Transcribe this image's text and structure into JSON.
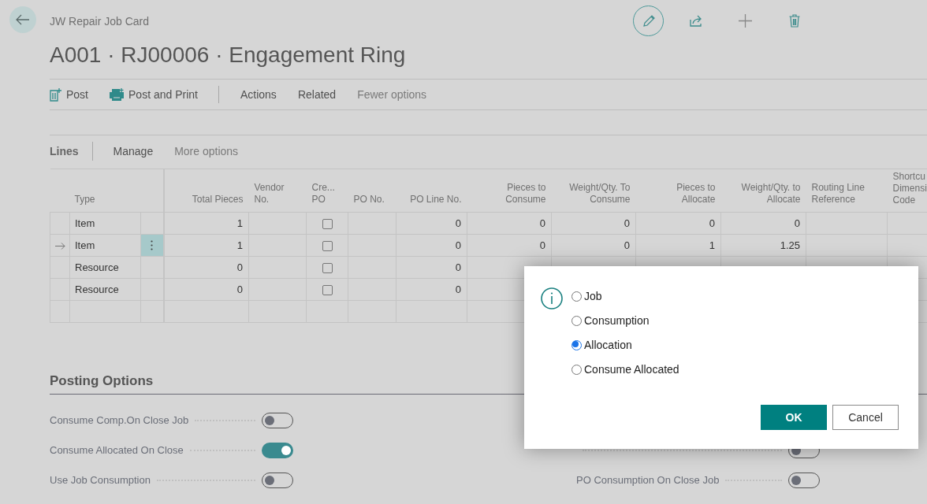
{
  "header": {
    "breadcrumb": "JW Repair Job Card",
    "title": "A001 · RJ00006 · Engagement Ring"
  },
  "action_bar": [
    {
      "label": "Post",
      "kind": "post"
    },
    {
      "label": "Post and Print",
      "kind": "print"
    },
    {
      "label": "Actions",
      "kind": "menu"
    },
    {
      "label": "Related",
      "kind": "menu"
    },
    {
      "label": "Fewer options",
      "kind": "more"
    }
  ],
  "lines": {
    "title": "Lines",
    "actions": [
      {
        "label": "Manage",
        "kind": "menu"
      },
      {
        "label": "More options",
        "kind": "more"
      }
    ],
    "table": {
      "columns": [
        {
          "label": "Total Pieces",
          "kind": "number"
        },
        {
          "label": "Vendor\nNo.",
          "kind": "text"
        },
        {
          "label": "Cre...\nPO",
          "kind": "checkbox"
        },
        {
          "label": "PO No.",
          "kind": "text"
        },
        {
          "label": "PO Line No.",
          "kind": "number"
        },
        {
          "label": "Pieces to\nConsume",
          "kind": "number"
        },
        {
          "label": "Weight/Qty. To\nConsume",
          "kind": "number"
        },
        {
          "label": "Pieces to\nAllocate",
          "kind": "number"
        },
        {
          "label": "Weight/Qty. to\nAllocate",
          "kind": "number"
        },
        {
          "label": "Routing Line\nReference",
          "kind": "text"
        },
        {
          "label": "Shortcu\nDimensi\nCode",
          "kind": "text"
        }
      ],
      "type_label": "Type",
      "rows": [
        {
          "selected": false,
          "type": "Item",
          "cells": [
            "1",
            null,
            false,
            null,
            "0",
            "0",
            "0",
            "0",
            "0",
            null,
            null
          ]
        },
        {
          "selected": true,
          "type": "Item",
          "cells": [
            "1",
            null,
            false,
            null,
            "0",
            "0",
            "0",
            "1",
            "1.25",
            null,
            null
          ]
        },
        {
          "selected": false,
          "type": "Resource",
          "cells": [
            "0",
            null,
            false,
            null,
            "0",
            null,
            null,
            null,
            null,
            null,
            null
          ]
        },
        {
          "selected": false,
          "type": "Resource",
          "cells": [
            "0",
            null,
            false,
            null,
            "0",
            null,
            null,
            null,
            null,
            null,
            null
          ]
        },
        {
          "selected": false
        }
      ]
    }
  },
  "posting_options": {
    "title": "Posting Options",
    "left_fields": [
      {
        "label": "Consume Comp.On Close Job",
        "on": false
      },
      {
        "label": "Consume Allocated On Close",
        "on": true
      },
      {
        "label": "Use Job Consumption",
        "on": false
      }
    ],
    "right_fields": [
      {
        "on": false
      },
      {
        "label": "PO Consumption On Close Job",
        "on": false
      }
    ]
  },
  "dialog": {
    "options": [
      {
        "label": "Job",
        "selected": false
      },
      {
        "label": "Consumption",
        "selected": false
      },
      {
        "label": "Allocation",
        "selected": true
      },
      {
        "label": "Consume Allocated",
        "selected": false
      }
    ],
    "buttons": [
      {
        "label": "OK",
        "kind": "primary"
      },
      {
        "label": "Cancel",
        "kind": "secondary"
      }
    ]
  }
}
